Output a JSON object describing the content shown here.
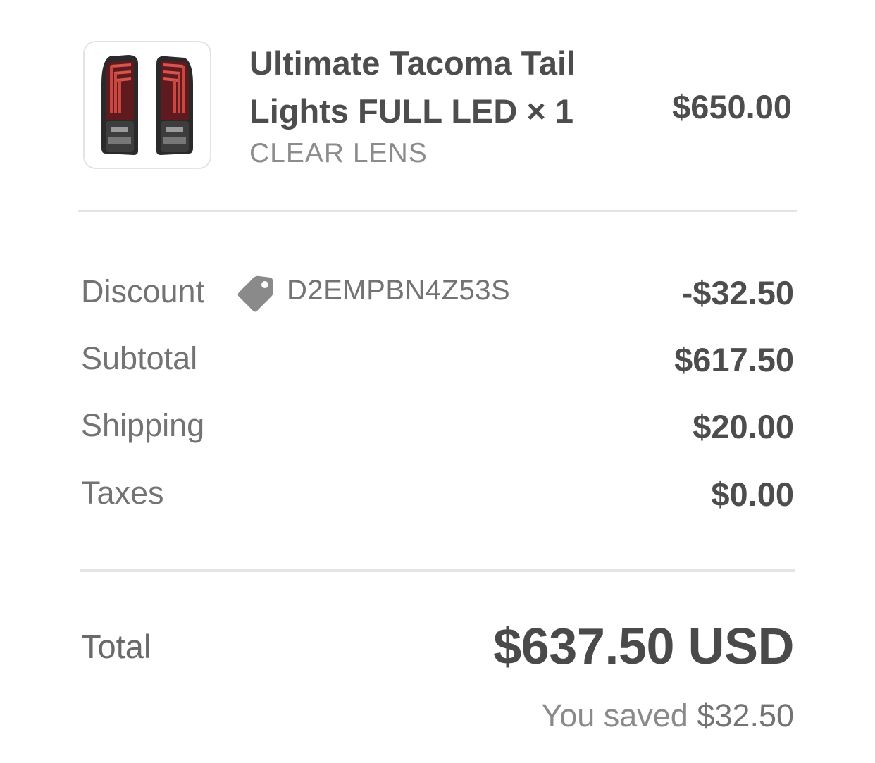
{
  "product": {
    "title": "Ultimate Tacoma Tail Lights FULL LED × 1",
    "variant": "CLEAR LENS",
    "price": "$650.00",
    "image_icon": "tail-lights-product-image"
  },
  "summary": {
    "discount": {
      "label": "Discount",
      "code": "D2EMPBN4Z53S",
      "icon": "tag-icon",
      "value": "-$32.50"
    },
    "subtotal": {
      "label": "Subtotal",
      "value": "$617.50"
    },
    "shipping": {
      "label": "Shipping",
      "value": "$20.00"
    },
    "taxes": {
      "label": "Taxes",
      "value": "$0.00"
    }
  },
  "total": {
    "label": "Total",
    "value": "$637.50 USD",
    "saved_prefix": "You saved",
    "saved_amount": "$32.50"
  },
  "colors": {
    "text_primary": "#4d4d4d",
    "text_secondary": "#737373",
    "divider": "#e4e4e4",
    "tag_icon": "#8a8a8a"
  }
}
